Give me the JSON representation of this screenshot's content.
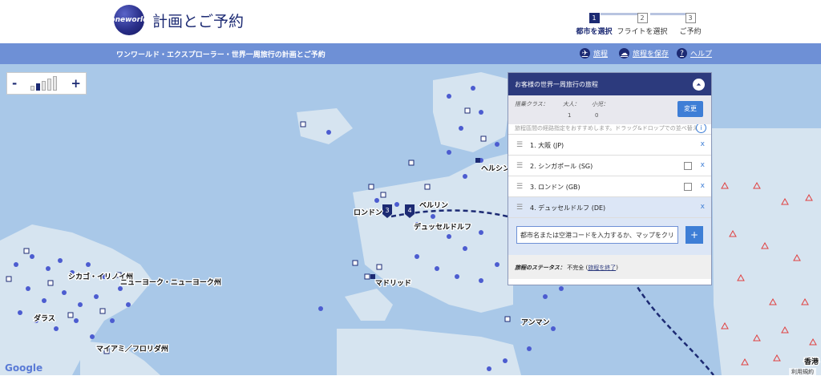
{
  "header": {
    "logo_text": "oneworld",
    "title": "計画とご予約",
    "steps": [
      {
        "num": "1",
        "label": "都市を選択",
        "active": true
      },
      {
        "num": "2",
        "label": "フライトを選択",
        "active": false
      },
      {
        "num": "3",
        "label": "ご予約",
        "active": false
      }
    ]
  },
  "subbar": {
    "title": "ワンワールド・エクスプローラー・世界一周旅行の計画とご予約",
    "links": [
      {
        "label": "旅程",
        "icon": "plane-icon"
      },
      {
        "label": "旅程を保存",
        "icon": "save-icon"
      },
      {
        "label": "ヘルプ",
        "icon": "help-icon"
      }
    ]
  },
  "zoom": {
    "minus": "-",
    "plus": "+"
  },
  "map_labels": [
    "ヘルシンキ",
    "ベルリン",
    "ロンドン",
    "デュッセルドルフ",
    "マドリッド",
    "シカゴ・イリノイ州",
    "ニューヨーク・ニューヨーク州",
    "ダラス",
    "マイアミ／フロリダ州",
    "アンマン",
    "香港"
  ],
  "map_markers": [
    "3",
    "4"
  ],
  "panel": {
    "title": "お客様の世界一周旅行の旅程",
    "toggle": "⏶",
    "class_label": "搭乗クラス：",
    "adult_label": "大人：",
    "adult_value": "1",
    "child_label": "小児：",
    "child_value": "0",
    "change_btn": "変更",
    "note": "旅程區間の経路指定をおすすめします。ドラッグ&ドロップでの並べ替え",
    "cities": [
      {
        "label": "1. 大阪 (JP)",
        "has_check": false
      },
      {
        "label": "2. シンガポール (SG)",
        "has_check": true
      },
      {
        "label": "3. ロンドン (GB)",
        "has_check": true
      },
      {
        "label": "4. デュッセルドルフ (DE)",
        "has_check": false
      }
    ],
    "delete_label": "x",
    "input_value": "都市名または空港コードを入力するか、マップをクリ",
    "add_btn": "+",
    "status_label": "旅程のステータス：",
    "status_value": "不完全 (",
    "status_link": "旅程を終了",
    "status_end": ")"
  },
  "footer": {
    "google": "Google",
    "terms": "利用規約"
  },
  "colors": {
    "navy": "#1c2a73",
    "subbar": "#6e90d6",
    "sea": "#a9c8e8",
    "land": "#d6e4f0",
    "dot": "#4c5cd0"
  }
}
